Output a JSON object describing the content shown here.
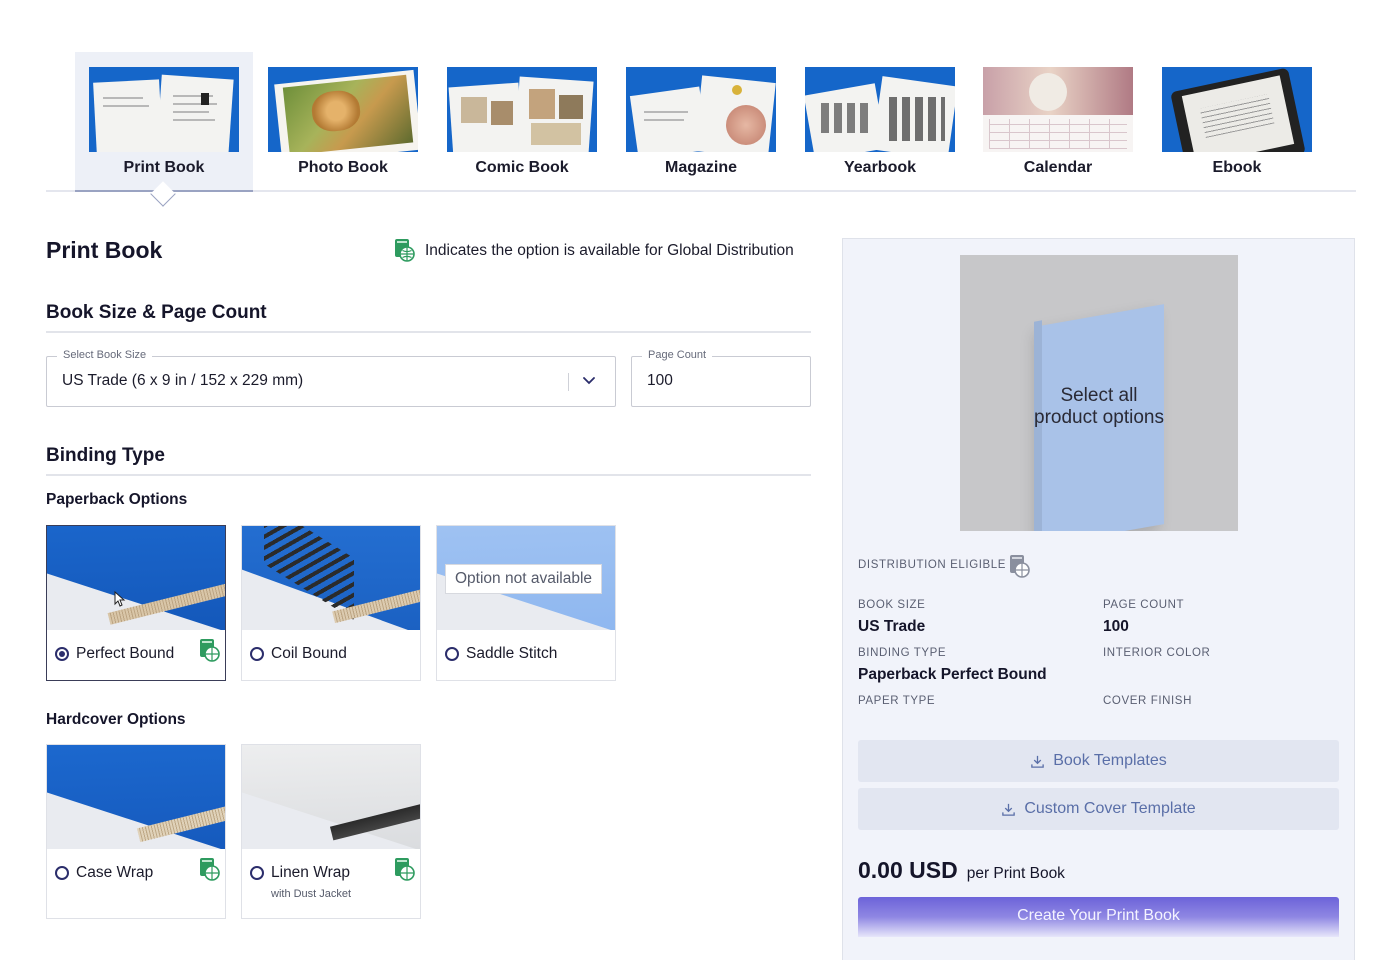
{
  "product_tabs": [
    {
      "label": "Print Book",
      "active": true
    },
    {
      "label": "Photo Book",
      "active": false
    },
    {
      "label": "Comic Book",
      "active": false
    },
    {
      "label": "Magazine",
      "active": false
    },
    {
      "label": "Yearbook",
      "active": false
    },
    {
      "label": "Calendar",
      "active": false
    },
    {
      "label": "Ebook",
      "active": false
    }
  ],
  "page_title": "Print Book",
  "global_distribution_note": "Indicates the option is available for Global Distribution",
  "book_size_section": {
    "heading": "Book Size & Page Count",
    "book_size": {
      "label": "Select Book Size",
      "value": "US Trade (6 x 9 in / 152 x 229 mm)"
    },
    "page_count": {
      "label": "Page Count",
      "value": "100"
    }
  },
  "binding_section": {
    "heading": "Binding Type",
    "paperback_heading": "Paperback Options",
    "paperback_options": [
      {
        "name": "Perfect Bound",
        "selected": true,
        "global": true
      },
      {
        "name": "Coil Bound",
        "selected": false,
        "global": false
      },
      {
        "name": "Saddle Stitch",
        "selected": false,
        "global": false,
        "tooltip": "Option not available"
      }
    ],
    "hardcover_heading": "Hardcover Options",
    "hardcover_options": [
      {
        "name": "Case Wrap",
        "selected": false,
        "global": true
      },
      {
        "name": "Linen Wrap",
        "subtitle": "with Dust Jacket",
        "selected": false,
        "global": true
      }
    ]
  },
  "summary": {
    "preview_message_line1": "Select all",
    "preview_message_line2": "product options",
    "distribution_label": "DISTRIBUTION ELIGIBLE",
    "book_size_label": "BOOK SIZE",
    "book_size_value": "US Trade",
    "page_count_label": "PAGE COUNT",
    "page_count_value": "100",
    "binding_type_label": "BINDING TYPE",
    "binding_type_value": "Paperback Perfect Bound",
    "interior_color_label": "INTERIOR COLOR",
    "paper_type_label": "PAPER TYPE",
    "cover_finish_label": "COVER FINISH",
    "book_templates_button": "Book Templates",
    "custom_cover_button": "Custom Cover Template",
    "price_amount": "0.00 USD",
    "price_per": "per Print Book",
    "cta_button": "Create Your Print Book"
  },
  "colors": {
    "accent_blue": "#1566c9",
    "global_icon_green": "#2e9b5f",
    "cta_purple": "#6c63d9",
    "panel_bg": "#f1f3fa"
  },
  "icons": [
    "global-distribution-icon",
    "chevron-down-icon",
    "download-icon",
    "cursor-icon"
  ]
}
